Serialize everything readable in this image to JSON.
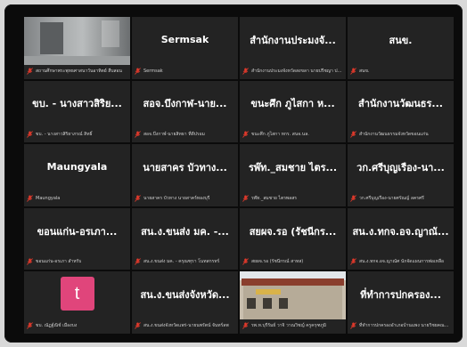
{
  "colors": {
    "background": "#0b0b0b",
    "tile": "#232323",
    "muted_mic": "#e0392b",
    "avatar": "#e0457b"
  },
  "participants": [
    {
      "name": "",
      "label": "สถานศึกษาพระพุทธศาสนาวันอาทิตย์ สืบสอน",
      "video": "room"
    },
    {
      "name": "Sermsak",
      "label": "Sermsak"
    },
    {
      "name": "สำนักงานประมงจั...",
      "label": "สำนักงานประมงจังหวัดสงขลา นายปรีชญา ปลอด..."
    },
    {
      "name": "สนข.",
      "label": "สนข."
    },
    {
      "name": "ขบ. - นางสาวสิริย...",
      "label": "ขบ. - นางสาวสิริยาภรณ์ สิทธิ์"
    },
    {
      "name": "สอจ.บึงกาฬ-นาย...",
      "label": "สอจ.บึงกาฬ-นายสิทธา ที่ดีปรอม"
    },
    {
      "name": "ขนะศึก ภูไสกา ห...",
      "label": "ขนะศึก ภูไสกา หกร. สนจ.นล."
    },
    {
      "name": "สำนักงานวัฒนธร...",
      "label": "สำนักงานวัฒนธรรมจังหวัดขอนแก่น"
    },
    {
      "name": "Maungyala",
      "label": "Maungyala"
    },
    {
      "name": "นายสาคร บัวทาง...",
      "label": "นายสาคร บัวทาง นายสาคร์ทองบุรี"
    },
    {
      "name": "รพ๊ท._สมชาย ไตร...",
      "label": "รพ๊ท._สมชาย ไตรพลสร"
    },
    {
      "name": "วก.ศรีบุญเรือง-นา...",
      "label": "วก.ศรีบุญเรือง-นายศรัณญ์ ลครศรี"
    },
    {
      "name": "ขอนแก่น-อรเภา...",
      "label": "ขอนแก่น-อรเภา สำหรับ"
    },
    {
      "name": "สน.ง.ขนส่ง มค. -...",
      "label": "สน.ง.ขนส่ง มค. - ครุณฑุรา โนทสกรทร์"
    },
    {
      "name": "สยผจ.รอ (รัชนีกร...",
      "label": "สยผจ.รอ (รัชนีกรณ์ สาทส)"
    },
    {
      "name": "สน.ง.ทกจ.อจ.ญาณั...",
      "label": "สน.ง.ทกจ.อจ.ญาณัศ นักจัดแผนการพ่อเหลือ"
    },
    {
      "name": "",
      "label": "ขบ. ณัฏฐ์ณิช์ เมืองบง",
      "avatar": "t"
    },
    {
      "name": "สน.ง.ขนส่งจังหวัด...",
      "label": "สน.ง.ขนส่งจังหวัดแพร่-นายนพรัตน์ จันทร์ลพ"
    },
    {
      "name": "",
      "label": "รพ.ท.บุรีรัมย์ วาจิ วาณวิชญ์ ครูครุฑภูมิ",
      "video": "building"
    },
    {
      "name": "ที่ทำการปกครอง...",
      "label": "ที่ทำการปกครองอำเภอบ้านแพง นายวิชยคณ..."
    }
  ]
}
